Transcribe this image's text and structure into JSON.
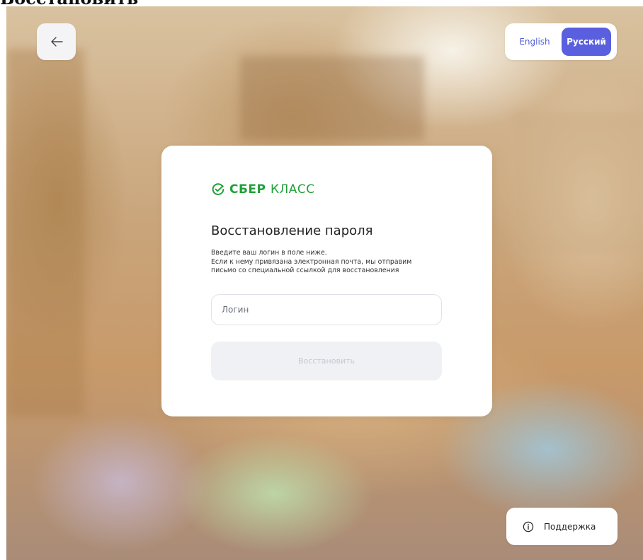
{
  "page_caption": "Восстановить",
  "header": {
    "back_icon": "arrow-left-icon",
    "languages": [
      {
        "label": "English",
        "active": false
      },
      {
        "label": "Русский",
        "active": true
      }
    ]
  },
  "card": {
    "logo": {
      "brand": "СБЕР",
      "product": "КЛАСС",
      "icon": "sber-check-icon",
      "color": "#21a038"
    },
    "title": "Восстановление пароля",
    "description_lines": [
      "Введите ваш логин в поле ниже.",
      "Если к нему привязана электронная почта, мы отправим",
      "письмо со специальной ссылкой для восстановления"
    ],
    "login_placeholder": "Логин",
    "login_value": "",
    "submit_label": "Восстановить",
    "submit_enabled": false
  },
  "support": {
    "icon": "info-icon",
    "label": "Поддержка"
  },
  "colors": {
    "accent": "#5a5fe0",
    "brand": "#21a038"
  }
}
